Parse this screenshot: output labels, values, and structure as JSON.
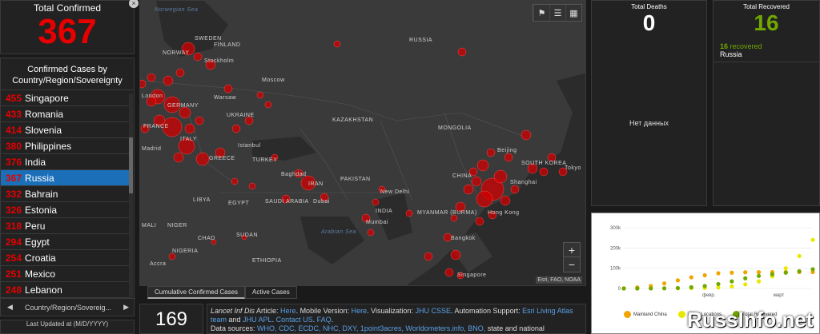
{
  "total_confirmed": {
    "label": "Total Confirmed",
    "value": "367"
  },
  "list": {
    "header": "Confirmed Cases by Country/Region/Sovereignty",
    "items": [
      {
        "count": "455",
        "name": "Singapore"
      },
      {
        "count": "433",
        "name": "Romania"
      },
      {
        "count": "414",
        "name": "Slovenia"
      },
      {
        "count": "380",
        "name": "Philippines"
      },
      {
        "count": "376",
        "name": "India"
      },
      {
        "count": "367",
        "name": "Russia",
        "selected": true
      },
      {
        "count": "332",
        "name": "Bahrain"
      },
      {
        "count": "326",
        "name": "Estonia"
      },
      {
        "count": "318",
        "name": "Peru"
      },
      {
        "count": "294",
        "name": "Egypt"
      },
      {
        "count": "254",
        "name": "Croatia"
      },
      {
        "count": "251",
        "name": "Mexico"
      },
      {
        "count": "248",
        "name": "Lebanon"
      }
    ],
    "nav_label": "Country/Region/Sovereig..."
  },
  "updated": {
    "label": "Last Updated at (M/D/YYYY)"
  },
  "map": {
    "labels": {
      "russia": "RUSSIA",
      "finland": "FINLAND",
      "sweden": "SWEDEN",
      "norway": "NORWAY",
      "norwegian_sea": "Norwegian Sea",
      "stockholm": "Stockholm",
      "moscow": "Moscow",
      "warsaw": "Warsaw",
      "ukraine": "UKRAINE",
      "germany": "GERMANY",
      "france": "FRANCE",
      "madrid": "Madrid",
      "italy": "ITALY",
      "greece": "GREECE",
      "turkey": "TURKEY",
      "istanbul": "Istanbul",
      "kazakhstan": "KAZAKHSTAN",
      "mongolia": "MONGOLIA",
      "china": "CHINA",
      "beijing": "Beijing",
      "shanghai": "Shanghai",
      "tokyo": "Tokyo",
      "south_korea": "SOUTH KOREA",
      "baghdad": "Baghdad",
      "iran": "IRAN",
      "dubai": "Dubai",
      "saudi_arabia": "SAUDI ARABIA",
      "libya": "LIBYA",
      "egypt": "EGYPT",
      "new_delhi": "New Delhi",
      "india": "INDIA",
      "mumbai": "Mumbai",
      "myanmar": "MYANMAR (BURMA)",
      "hong_kong": "Hong Kong",
      "bangkok": "Bangkok",
      "singapore": "Singapore",
      "arabian_sea": "Arabian Sea",
      "chad": "CHAD",
      "sudan": "SUDAN",
      "nigeria": "NIGERIA",
      "ethiopia": "ETHIOPIA",
      "mali": "MALI",
      "niger": "NIGER",
      "accra": "Accra",
      "pakistan": "PAKISTAN",
      "london": "London"
    },
    "attribution": "Esri, FAO, NOAA",
    "zoom_in": "+",
    "zoom_out": "−"
  },
  "map_tabs": [
    "Cumulative Confirmed Cases",
    "Active Cases"
  ],
  "country_count": "169",
  "info": {
    "t1": "Lancet Inf Dis",
    "t2": " Article: ",
    "here1": "Here",
    "t3": ". Mobile Version: ",
    "here2": "Here",
    "t4": ". Visualization: ",
    "jhu_csse": "JHU CSSE",
    "t5": ". Automation Support: ",
    "esri": "Esri Living Atlas team",
    "t6": " and ",
    "jhu_apl": "JHU APL",
    "t7": ". ",
    "contact": "Contact US",
    "t8": ". ",
    "faq": "FAQ",
    "t9": ".",
    "sources_label": "Data sources: ",
    "sources": "WHO, CDC, ECDC, NHC, DXY, 1point3acres, Worldometers.info, BNO,",
    "sources_tail": " state and national"
  },
  "deaths": {
    "label": "Total Deaths",
    "value": "0",
    "nodata": "Нет данных"
  },
  "recovered": {
    "label": "Total Recovered",
    "value": "16",
    "row_count": "16",
    "row_text": " recovered",
    "row_country": "Russia"
  },
  "chart_data": {
    "type": "line",
    "y_ticks": [
      "300k",
      "200k",
      "100k",
      "0"
    ],
    "ylim": [
      0,
      300000
    ],
    "x_ticks": [
      "февр.",
      "март"
    ],
    "series": [
      {
        "name": "Mainland China",
        "color": "#f0a500",
        "values": [
          500,
          5000,
          12000,
          25000,
          40000,
          55000,
          65000,
          75000,
          78000,
          80000,
          80500,
          80800,
          81000,
          81000,
          81000
        ]
      },
      {
        "name": "Other Locations",
        "color": "#e8e800",
        "values": [
          0,
          100,
          300,
          500,
          800,
          1500,
          2500,
          5000,
          10000,
          20000,
          35000,
          60000,
          100000,
          160000,
          240000
        ]
      },
      {
        "name": "Total Recovered",
        "color": "#70a800",
        "values": [
          0,
          50,
          200,
          800,
          2000,
          6000,
          12000,
          22000,
          35000,
          50000,
          62000,
          70000,
          78000,
          85000,
          95000
        ]
      }
    ]
  }
}
